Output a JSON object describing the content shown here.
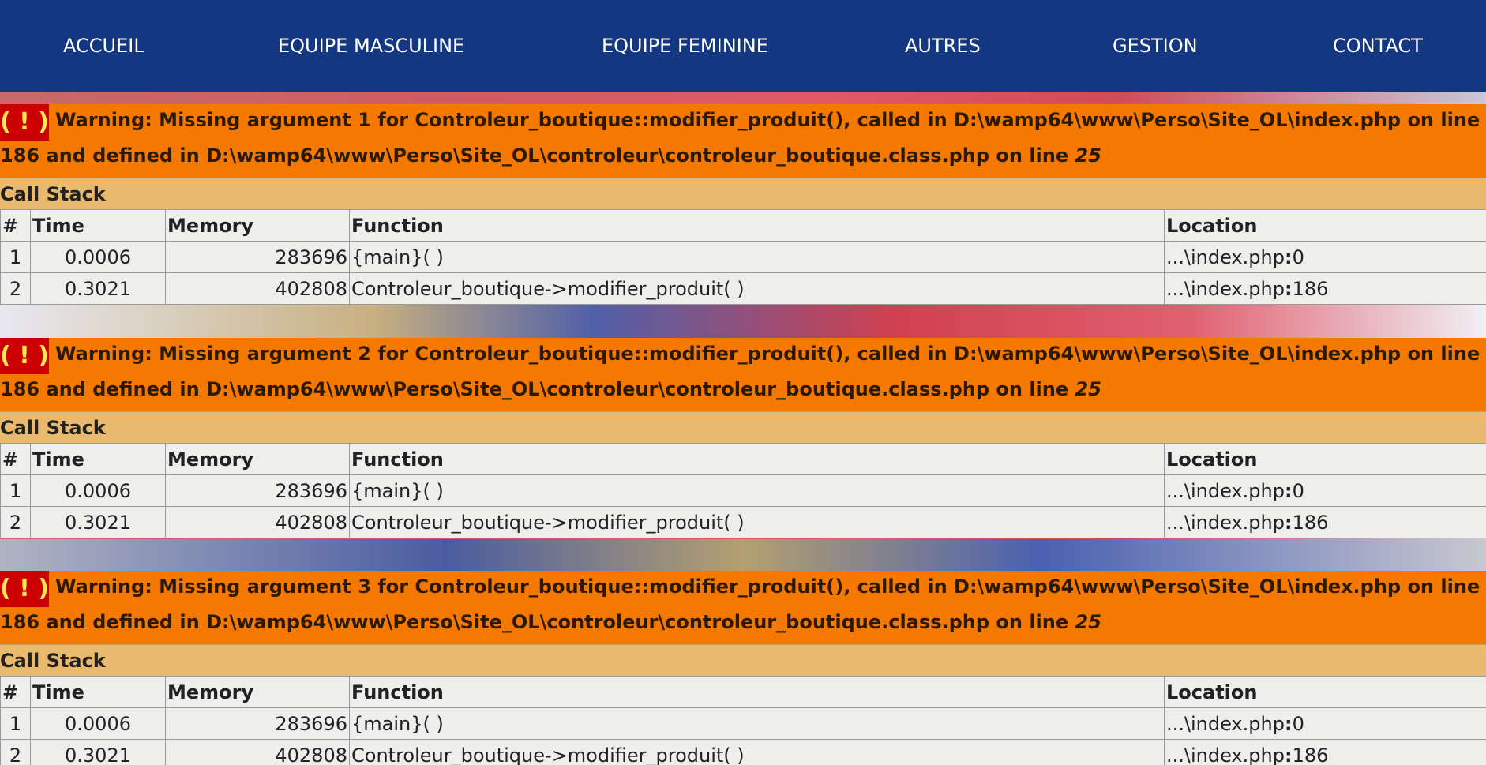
{
  "nav": {
    "items": [
      "ACCUEIL",
      "EQUIPE MASCULINE",
      "EQUIPE FEMININE",
      "AUTRES",
      "GESTION",
      "CONTACT"
    ]
  },
  "colors": {
    "nav_bg": "#133881",
    "warning_bg": "#f57900",
    "callstack_bg": "#e9b96e",
    "bang_bg": "#cc0000",
    "bang_fg": "#fce94f",
    "table_bg": "#eeeeec"
  },
  "errors": [
    {
      "bang": "( ! )",
      "message": "Warning: Missing argument 1 for Controleur_boutique::modifier_produit(), called in D:\\wamp64\\www\\Perso\\Site_OL\\index.php on line 186 and defined in D:\\wamp64\\www\\Perso\\Site_OL\\controleur\\controleur_boutique.class.php on line ",
      "line": "25",
      "callstack_label": "Call Stack",
      "headers": [
        "#",
        "Time",
        "Memory",
        "Function",
        "Location"
      ],
      "rows": [
        {
          "num": "1",
          "time": "0.0006",
          "memory": "283696",
          "function": "{main}( )",
          "location": "...\\index.php",
          "loc_line": "0"
        },
        {
          "num": "2",
          "time": "0.3021",
          "memory": "402808",
          "function": "Controleur_boutique->modifier_produit( )",
          "location": "...\\index.php",
          "loc_line": "186"
        }
      ]
    },
    {
      "bang": "( ! )",
      "message": "Warning: Missing argument 2 for Controleur_boutique::modifier_produit(), called in D:\\wamp64\\www\\Perso\\Site_OL\\index.php on line 186 and defined in D:\\wamp64\\www\\Perso\\Site_OL\\controleur\\controleur_boutique.class.php on line ",
      "line": "25",
      "callstack_label": "Call Stack",
      "headers": [
        "#",
        "Time",
        "Memory",
        "Function",
        "Location"
      ],
      "rows": [
        {
          "num": "1",
          "time": "0.0006",
          "memory": "283696",
          "function": "{main}( )",
          "location": "...\\index.php",
          "loc_line": "0"
        },
        {
          "num": "2",
          "time": "0.3021",
          "memory": "402808",
          "function": "Controleur_boutique->modifier_produit( )",
          "location": "...\\index.php",
          "loc_line": "186"
        }
      ]
    },
    {
      "bang": "( ! )",
      "message": "Warning: Missing argument 3 for Controleur_boutique::modifier_produit(), called in D:\\wamp64\\www\\Perso\\Site_OL\\index.php on line 186 and defined in D:\\wamp64\\www\\Perso\\Site_OL\\controleur\\controleur_boutique.class.php on line ",
      "line": "25",
      "callstack_label": "Call Stack",
      "headers": [
        "#",
        "Time",
        "Memory",
        "Function",
        "Location"
      ],
      "rows": [
        {
          "num": "1",
          "time": "0.0006",
          "memory": "283696",
          "function": "{main}( )",
          "location": "...\\index.php",
          "loc_line": "0"
        },
        {
          "num": "2",
          "time": "0.3021",
          "memory": "402808",
          "function": "Controleur_boutique->modifier_produit( )",
          "location": "...\\index.php",
          "loc_line": "186"
        }
      ]
    }
  ]
}
